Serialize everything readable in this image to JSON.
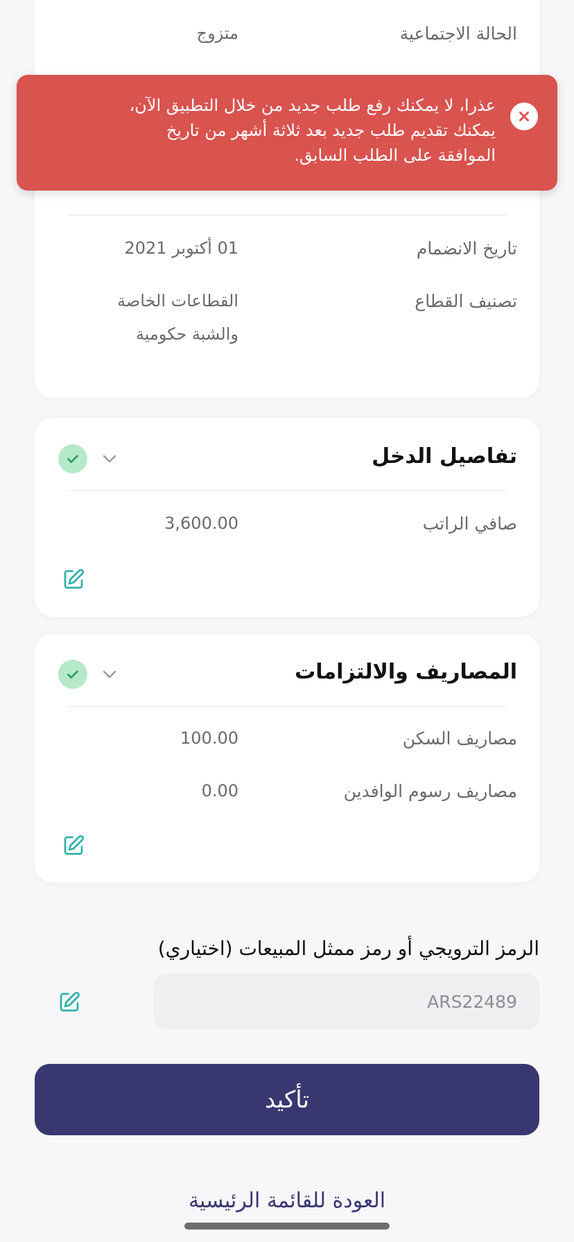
{
  "personal_card": {
    "marital_label": "الحالة الاجتماعية",
    "marital_value": "متزوج",
    "join_date_label": "تاريخ الانضمام",
    "join_date_value": "01 أكتوبر 2021",
    "sector_label": "تصنيف القطاع",
    "sector_value_line1": "القطاعات الخاصة",
    "sector_value_line2": "والشبة حكومية"
  },
  "income_card": {
    "title": "تفاصيل الدخل",
    "net_salary_label": "صافي الراتب",
    "net_salary_value": "3,600.00"
  },
  "expenses_card": {
    "title": "المصاريف والالتزامات",
    "housing_label": "مصاريف السكن",
    "housing_value": "100.00",
    "expat_fees_label": "مصاريف رسوم الوافدين",
    "expat_fees_value": "0.00"
  },
  "toast": {
    "line1": "عذرا، لا يمكنك رفع طلب جديد من خلال التطبيق الآن،",
    "line2": "يمكنك تقديم طلب جديد بعد ثلاثة أشهر من تاريخ",
    "line3": "الموافقة على الطلب السابق."
  },
  "promo": {
    "label": "الرمز الترويجي أو رمز ممثل المبيعات (اختياري)",
    "value": "ARS22489"
  },
  "actions": {
    "confirm_label": "تأكيد",
    "back_label": "العودة للقائمة الرئيسية"
  },
  "colors": {
    "primary": "#393770",
    "error": "#d9534f",
    "success": "#b6e9c9",
    "accent_icon": "#2bb3a7"
  },
  "icons": [
    "check-icon",
    "chevron-down-icon",
    "edit-icon",
    "close-icon"
  ]
}
